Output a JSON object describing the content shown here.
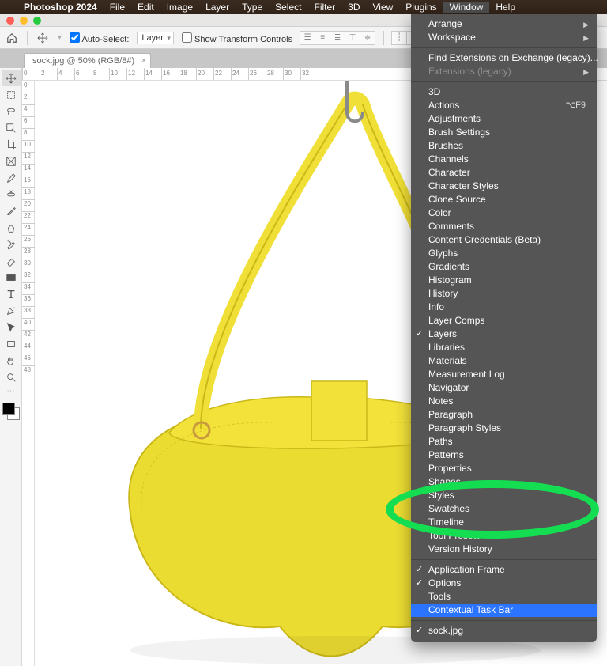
{
  "menubar": {
    "app": "Photoshop 2024",
    "items": [
      "File",
      "Edit",
      "Image",
      "Layer",
      "Type",
      "Select",
      "Filter",
      "3D",
      "View",
      "Plugins",
      "Window",
      "Help"
    ],
    "active": "Window"
  },
  "options": {
    "auto_select_label": "Auto-Select:",
    "auto_select_mode": "Layer",
    "show_transform_label": "Show Transform Controls"
  },
  "document": {
    "tab_label": "sock.jpg @ 50% (RGB/8#)"
  },
  "ruler": {
    "h_values": [
      "0",
      "2",
      "4",
      "6",
      "8",
      "10",
      "12",
      "14",
      "16",
      "18",
      "20",
      "22",
      "24",
      "26",
      "28",
      "30",
      "32"
    ],
    "v_values": [
      "0",
      "2",
      "4",
      "6",
      "8",
      "10",
      "12",
      "14",
      "16",
      "18",
      "20",
      "22",
      "24",
      "26",
      "28",
      "30",
      "32",
      "34",
      "36",
      "38",
      "40",
      "42",
      "44",
      "46",
      "48"
    ]
  },
  "tools": [
    {
      "n": "move"
    },
    {
      "n": "artboard"
    },
    {
      "n": "lasso"
    },
    {
      "n": "object-select"
    },
    {
      "n": "crop"
    },
    {
      "n": "frame"
    },
    {
      "n": "eyedropper-small"
    },
    {
      "n": "spot-heal"
    },
    {
      "n": "brush-small"
    },
    {
      "n": "clone"
    },
    {
      "n": "history-brush"
    },
    {
      "n": "eraser"
    },
    {
      "n": "gradient-rect"
    },
    {
      "n": "type"
    },
    {
      "n": "pen"
    },
    {
      "n": "path-select"
    },
    {
      "n": "rectangle"
    },
    {
      "n": "hand"
    },
    {
      "n": "zoom"
    }
  ],
  "window_menu": {
    "group1": [
      {
        "label": "Arrange",
        "sub": true
      },
      {
        "label": "Workspace",
        "sub": true
      }
    ],
    "group2": [
      {
        "label": "Find Extensions on Exchange (legacy)..."
      },
      {
        "label": "Extensions (legacy)",
        "sub": true,
        "disabled": true
      }
    ],
    "group3": [
      {
        "label": "3D"
      },
      {
        "label": "Actions",
        "shortcut": "⌥F9"
      },
      {
        "label": "Adjustments"
      },
      {
        "label": "Brush Settings"
      },
      {
        "label": "Brushes"
      },
      {
        "label": "Channels"
      },
      {
        "label": "Character"
      },
      {
        "label": "Character Styles"
      },
      {
        "label": "Clone Source"
      },
      {
        "label": "Color"
      },
      {
        "label": "Comments"
      },
      {
        "label": "Content Credentials (Beta)"
      },
      {
        "label": "Glyphs"
      },
      {
        "label": "Gradients"
      },
      {
        "label": "Histogram"
      },
      {
        "label": "History"
      },
      {
        "label": "Info"
      },
      {
        "label": "Layer Comps"
      },
      {
        "label": "Layers",
        "checked": true
      },
      {
        "label": "Libraries"
      },
      {
        "label": "Materials"
      },
      {
        "label": "Measurement Log"
      },
      {
        "label": "Navigator"
      },
      {
        "label": "Notes"
      },
      {
        "label": "Paragraph"
      },
      {
        "label": "Paragraph Styles"
      },
      {
        "label": "Paths"
      },
      {
        "label": "Patterns"
      },
      {
        "label": "Properties"
      },
      {
        "label": "Shapes"
      },
      {
        "label": "Styles"
      },
      {
        "label": "Swatches"
      },
      {
        "label": "Timeline"
      },
      {
        "label": "Tool Presets"
      },
      {
        "label": "Version History"
      }
    ],
    "group4": [
      {
        "label": "Application Frame",
        "checked": true
      },
      {
        "label": "Options",
        "checked": true
      },
      {
        "label": "Tools"
      },
      {
        "label": "Contextual Task Bar",
        "selected": true
      }
    ],
    "group5": [
      {
        "label": "sock.jpg",
        "checked": true
      }
    ]
  }
}
